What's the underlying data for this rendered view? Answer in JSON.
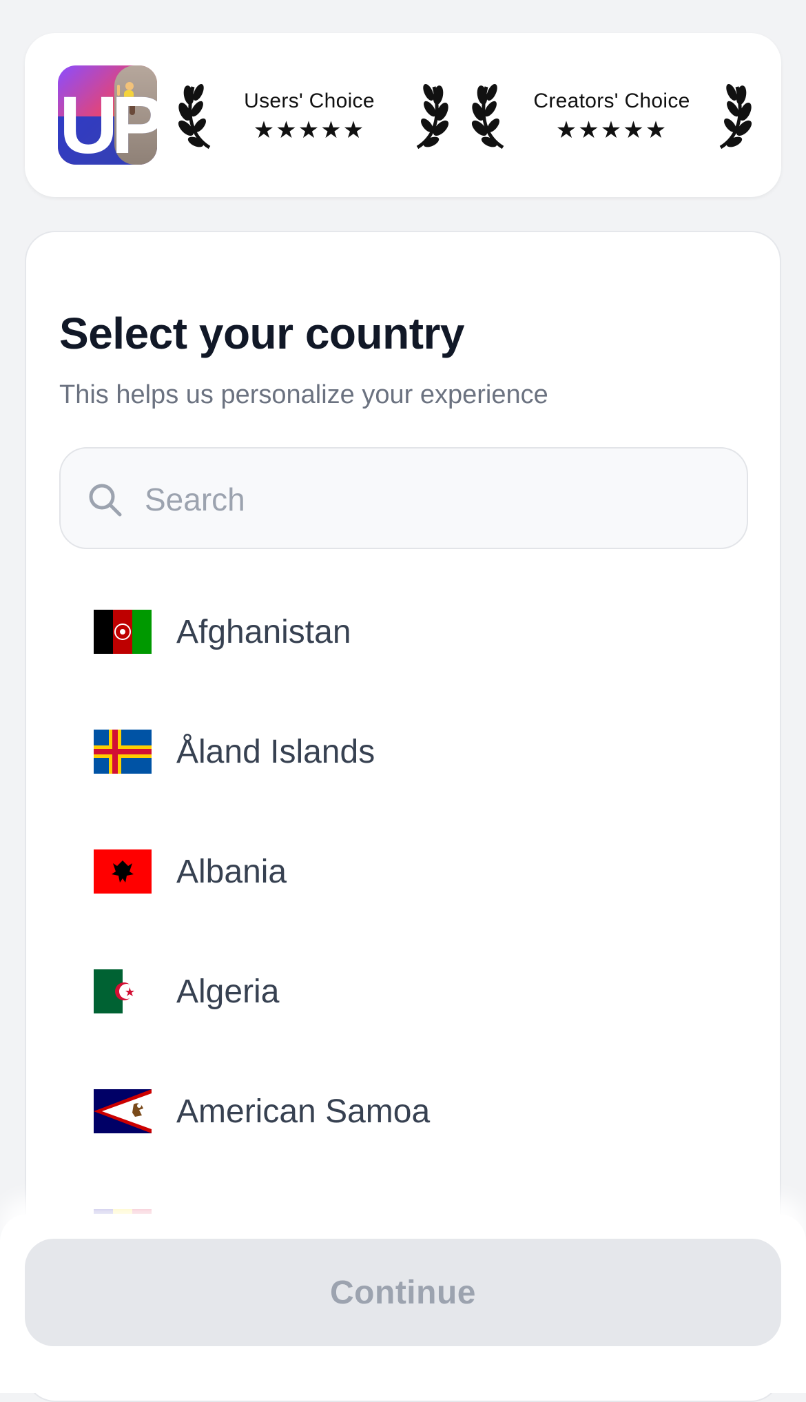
{
  "awards": [
    {
      "title": "Users' Choice",
      "stars": "★★★★★"
    },
    {
      "title": "Creators' Choice",
      "stars": "★★★★★"
    }
  ],
  "app_icon": {
    "logo_text": "UP"
  },
  "header": {
    "title": "Select your country",
    "subtitle": "This helps us personalize your experience"
  },
  "search": {
    "placeholder": "Search",
    "value": "",
    "icon": "search-icon"
  },
  "countries": [
    {
      "name": "Afghanistan",
      "flag": "afghanistan-flag"
    },
    {
      "name": "Åland Islands",
      "flag": "aland-islands-flag"
    },
    {
      "name": "Albania",
      "flag": "albania-flag"
    },
    {
      "name": "Algeria",
      "flag": "algeria-flag"
    },
    {
      "name": "American Samoa",
      "flag": "american-samoa-flag"
    }
  ],
  "footer": {
    "continue_label": "Continue",
    "continue_enabled": false
  },
  "colors": {
    "background": "#f2f3f5",
    "card": "#ffffff",
    "title": "#111827",
    "subtitle": "#6b7280",
    "button_disabled_bg": "#e5e7eb",
    "button_disabled_text": "#9ca3af"
  }
}
